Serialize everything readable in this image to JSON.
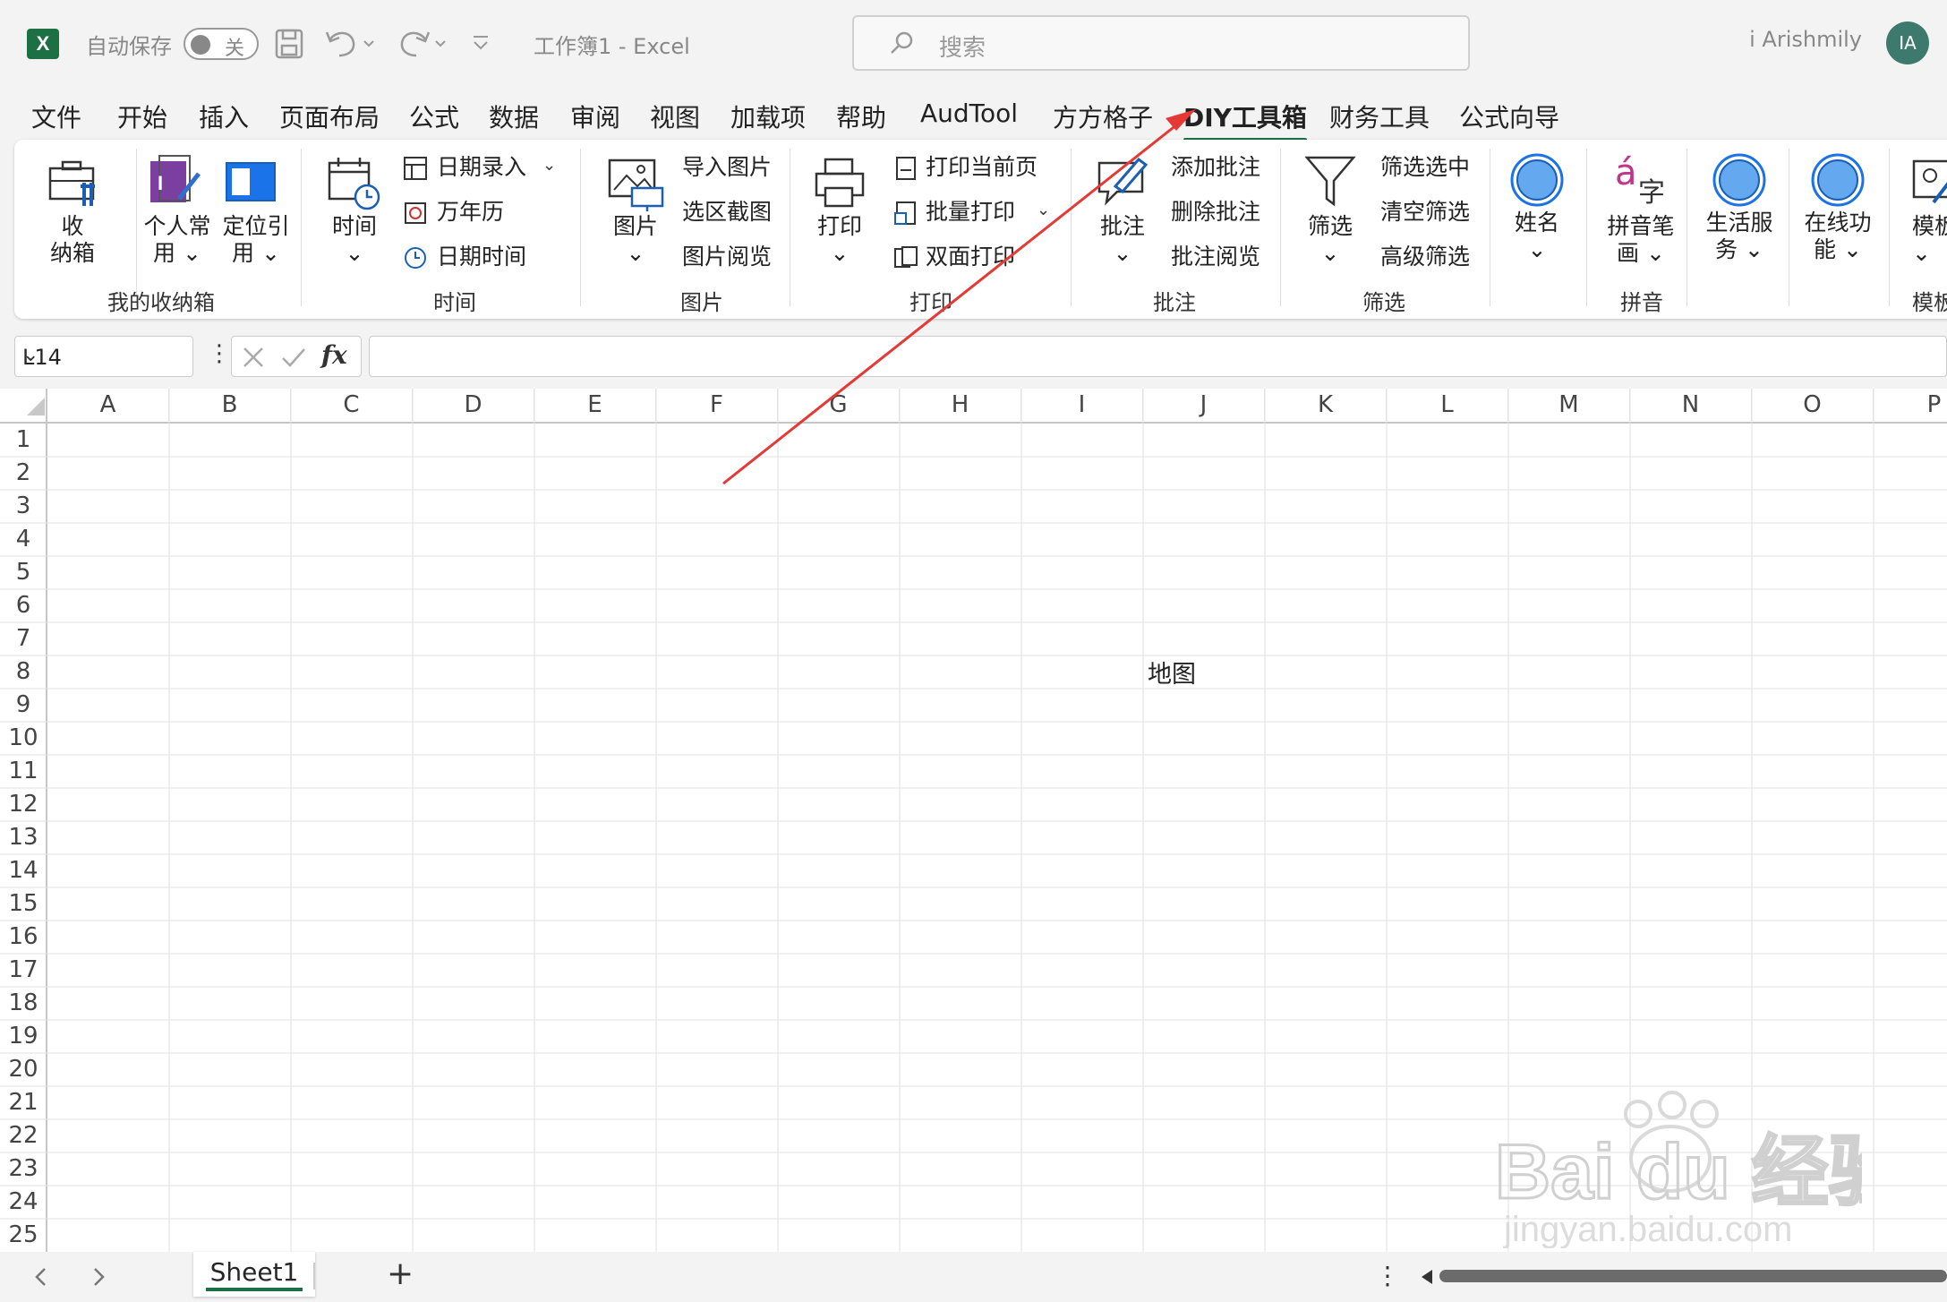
{
  "titlebar": {
    "app_logo": "X",
    "autosave_label": "自动保存",
    "autosave_state": "关",
    "doc_title": "工作簿1  -  Excel",
    "search_placeholder": "搜索",
    "user_name": "i Arishmily",
    "avatar_initials": "IA"
  },
  "menu_tabs": [
    "文件",
    "开始",
    "插入",
    "页面布局",
    "公式",
    "数据",
    "审阅",
    "视图",
    "加载项",
    "帮助",
    "AudTool",
    "方方格子",
    "DIY工具箱",
    "财务工具",
    "公式向导"
  ],
  "active_tab": "DIY工具箱",
  "ribbon": {
    "groups": {
      "storage": {
        "label": "我的收纳箱",
        "btn1_line1": "收",
        "btn1_line2": "纳箱",
        "btn2_line1": "个人常",
        "btn2_line2": "用",
        "btn3_line1": "定位引",
        "btn3_line2": "用"
      },
      "time": {
        "label": "时间",
        "big": "时间",
        "items": [
          "日期录入",
          "万年历",
          "日期时间"
        ]
      },
      "picture": {
        "label": "图片",
        "big": "图片",
        "items": [
          "导入图片",
          "选区截图",
          "图片阅览"
        ]
      },
      "print": {
        "label": "打印",
        "big": "打印",
        "items": [
          "打印当前页",
          "批量打印",
          "双面打印"
        ]
      },
      "comment": {
        "label": "批注",
        "big": "批注",
        "items": [
          "添加批注",
          "删除批注",
          "批注阅览"
        ]
      },
      "filter": {
        "label": "筛选",
        "big": "筛选",
        "items": [
          "筛选选中",
          "清空筛选",
          "高级筛选"
        ]
      },
      "name": {
        "big": "姓名"
      },
      "pinyin": {
        "label": "拼音",
        "glyph_a": "á",
        "glyph_zi": "字",
        "big_line1": "拼音笔",
        "big_line2": "画"
      },
      "life": {
        "big_line1": "生活服",
        "big_line2": "务"
      },
      "online": {
        "big_line1": "在线功",
        "big_line2": "能"
      },
      "template": {
        "big": "模板",
        "label": "模板"
      }
    }
  },
  "formula_bar": {
    "name_box": "L14",
    "fx": "fx",
    "value": ""
  },
  "sheet": {
    "columns": [
      "A",
      "B",
      "C",
      "D",
      "E",
      "F",
      "G",
      "H",
      "I",
      "J",
      "K",
      "L",
      "M",
      "N",
      "O",
      "P"
    ],
    "rows": [
      "1",
      "2",
      "3",
      "4",
      "5",
      "6",
      "7",
      "8",
      "9",
      "10",
      "11",
      "12",
      "13",
      "14",
      "15",
      "16",
      "17",
      "18",
      "19",
      "20",
      "21",
      "22",
      "23",
      "24",
      "25"
    ],
    "cell_J8": "地图"
  },
  "sheet_tabs": [
    "Sheet1"
  ],
  "add_sheet": "+",
  "watermark": {
    "brand": "Bai du 经验",
    "url": "jingyan.baidu.com"
  },
  "colors": {
    "excel_green": "#1d7044",
    "annotation_arrow": "#e53935",
    "accent_blue": "#0078d4"
  }
}
